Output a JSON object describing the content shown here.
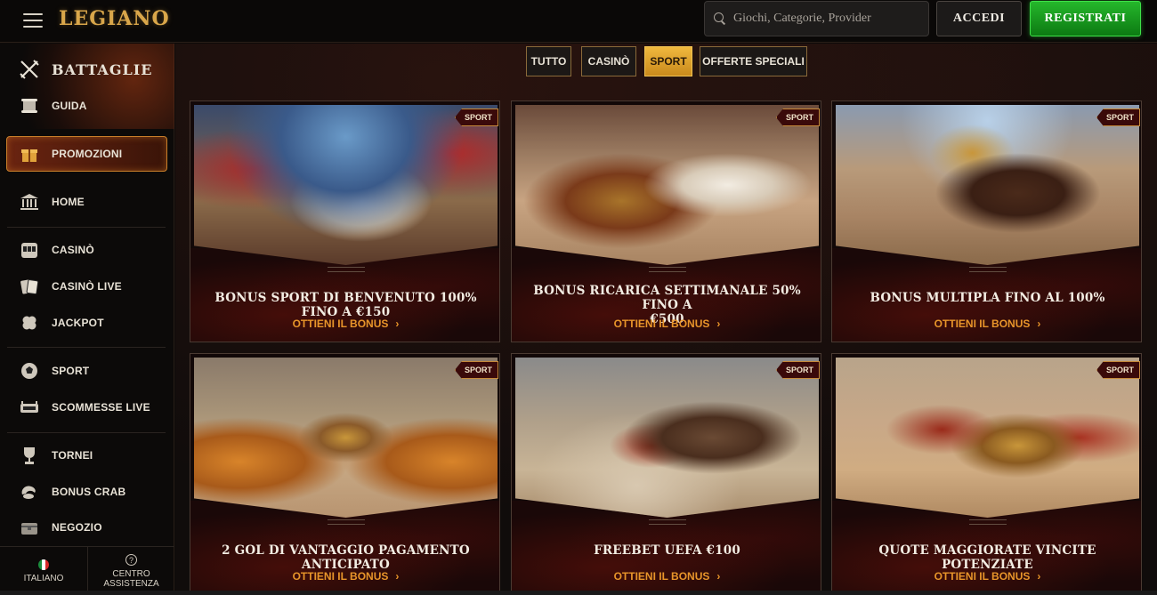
{
  "header": {
    "logo": "LEGIANO",
    "search_placeholder": "Giochi, Categorie, Provider",
    "login_label": "ACCEDI",
    "register_label": "REGISTRATI"
  },
  "sidebar": {
    "battle_label": "BATTAGLIE",
    "items": [
      {
        "label": "GUIDA",
        "icon": "scroll-icon"
      },
      {
        "label": "PROMOZIONI",
        "icon": "gift-icon"
      },
      {
        "label": "HOME",
        "icon": "temple-icon"
      },
      {
        "label": "CASINÒ",
        "icon": "slot-machine-icon"
      },
      {
        "label": "CASINÒ LIVE",
        "icon": "cards-icon"
      },
      {
        "label": "JACKPOT",
        "icon": "clover-icon"
      },
      {
        "label": "SPORT",
        "icon": "ball-icon"
      },
      {
        "label": "SCOMMESSE LIVE",
        "icon": "stadium-icon"
      },
      {
        "label": "TORNEI",
        "icon": "trophy-icon"
      },
      {
        "label": "BONUS CRAB",
        "icon": "claw-icon"
      },
      {
        "label": "NEGOZIO",
        "icon": "chest-icon"
      }
    ],
    "language_label": "ITALIANO",
    "help_label": "CENTRO ASSISTENZA"
  },
  "filters": [
    {
      "label": "TUTTO",
      "active": false
    },
    {
      "label": "CASINÒ",
      "active": false
    },
    {
      "label": "SPORT",
      "active": true
    },
    {
      "label": "OFFERTE SPECIALI",
      "active": false
    }
  ],
  "cards": [
    {
      "badge": "SPORT",
      "title_line1": "BONUS SPORT DI BENVENUTO 100% FINO A €150",
      "title_line2": "",
      "cta": "OTTIENI IL BONUS"
    },
    {
      "badge": "SPORT",
      "title_line1": "BONUS RICARICA SETTIMANALE 50% FINO A",
      "title_line2": "€500",
      "cta": "OTTIENI IL BONUS"
    },
    {
      "badge": "SPORT",
      "title_line1": "BONUS MULTIPLA FINO AL 100%",
      "title_line2": "",
      "cta": "OTTIENI IL BONUS"
    },
    {
      "badge": "SPORT",
      "title_line1": "2 GOL DI VANTAGGIO PAGAMENTO ANTICIPATO",
      "title_line2": "",
      "cta": "OTTIENI IL BONUS"
    },
    {
      "badge": "SPORT",
      "title_line1": "FREEBET UEFA €100",
      "title_line2": "",
      "cta": "OTTIENI IL BONUS"
    },
    {
      "badge": "SPORT",
      "title_line1": "QUOTE MAGGIORATE VINCITE POTENZIATE",
      "title_line2": "",
      "cta": "OTTIENI IL BONUS"
    }
  ],
  "colors": {
    "accent_gold": "#e8952a",
    "register_green": "#1ea525",
    "active_filter": "#f0b83e"
  }
}
